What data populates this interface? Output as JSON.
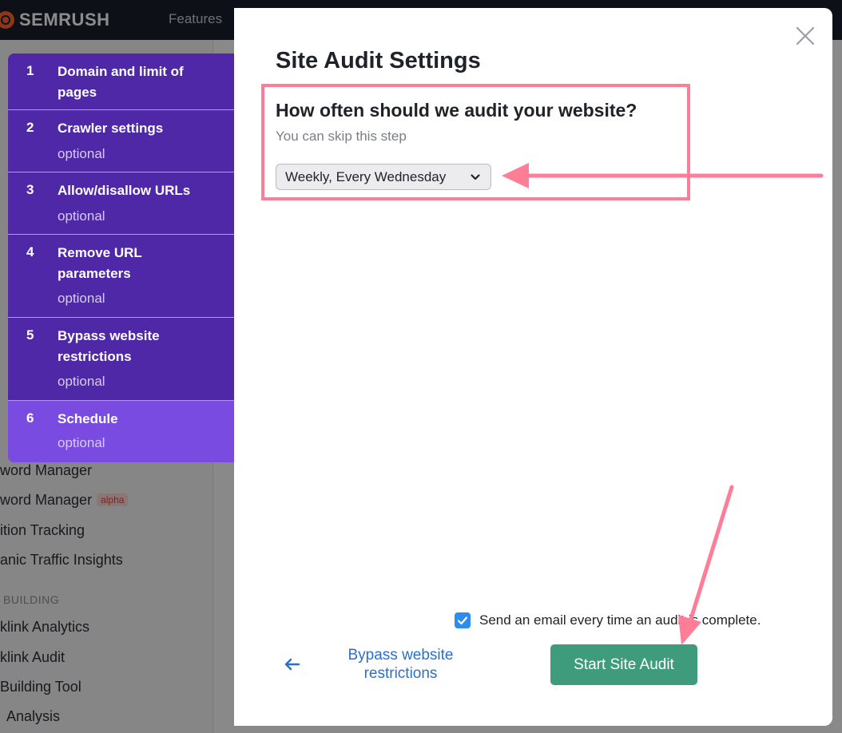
{
  "app": {
    "logo_text": "SEMRUSH",
    "nav_features": "Features"
  },
  "background": {
    "items": [
      {
        "label": "word Manager",
        "badge": ""
      },
      {
        "label": "word Manager",
        "badge": "alpha"
      },
      {
        "label": "ition Tracking",
        "badge": ""
      },
      {
        "label": "anic Traffic Insights",
        "badge": ""
      }
    ],
    "section_link_building": "BUILDING",
    "link_items": [
      "klink Analytics",
      "klink Audit",
      " Building Tool",
      "Analysis"
    ]
  },
  "steps": [
    {
      "number": "1",
      "title": "Domain and limit of pages",
      "optional": ""
    },
    {
      "number": "2",
      "title": "Crawler settings",
      "optional": "optional"
    },
    {
      "number": "3",
      "title": "Allow/disallow URLs",
      "optional": "optional"
    },
    {
      "number": "4",
      "title": "Remove URL parameters",
      "optional": "optional"
    },
    {
      "number": "5",
      "title": "Bypass website restrictions",
      "optional": "optional"
    },
    {
      "number": "6",
      "title": "Schedule",
      "optional": "optional"
    }
  ],
  "modal": {
    "title": "Site Audit Settings",
    "question": "How often should we audit your website?",
    "skip_hint": "You can skip this step",
    "schedule_value": "Weekly, Every Wednesday",
    "email_checkbox_label": "Send an email every time an audit is complete.",
    "email_checked": true,
    "back_label": "Bypass website restrictions",
    "start_label": "Start Site Audit"
  },
  "colors": {
    "steps_bg": "#4f28a7",
    "step_active": "#7a4be0",
    "start_button": "#3e9c7d",
    "link": "#2c6fc6",
    "annotation": "#ff7d96",
    "checkbox": "#2d8cf0"
  },
  "icons": {
    "close": "close-icon",
    "chevron": "chevron-down-icon",
    "back": "arrow-left-icon",
    "check": "check-icon"
  }
}
